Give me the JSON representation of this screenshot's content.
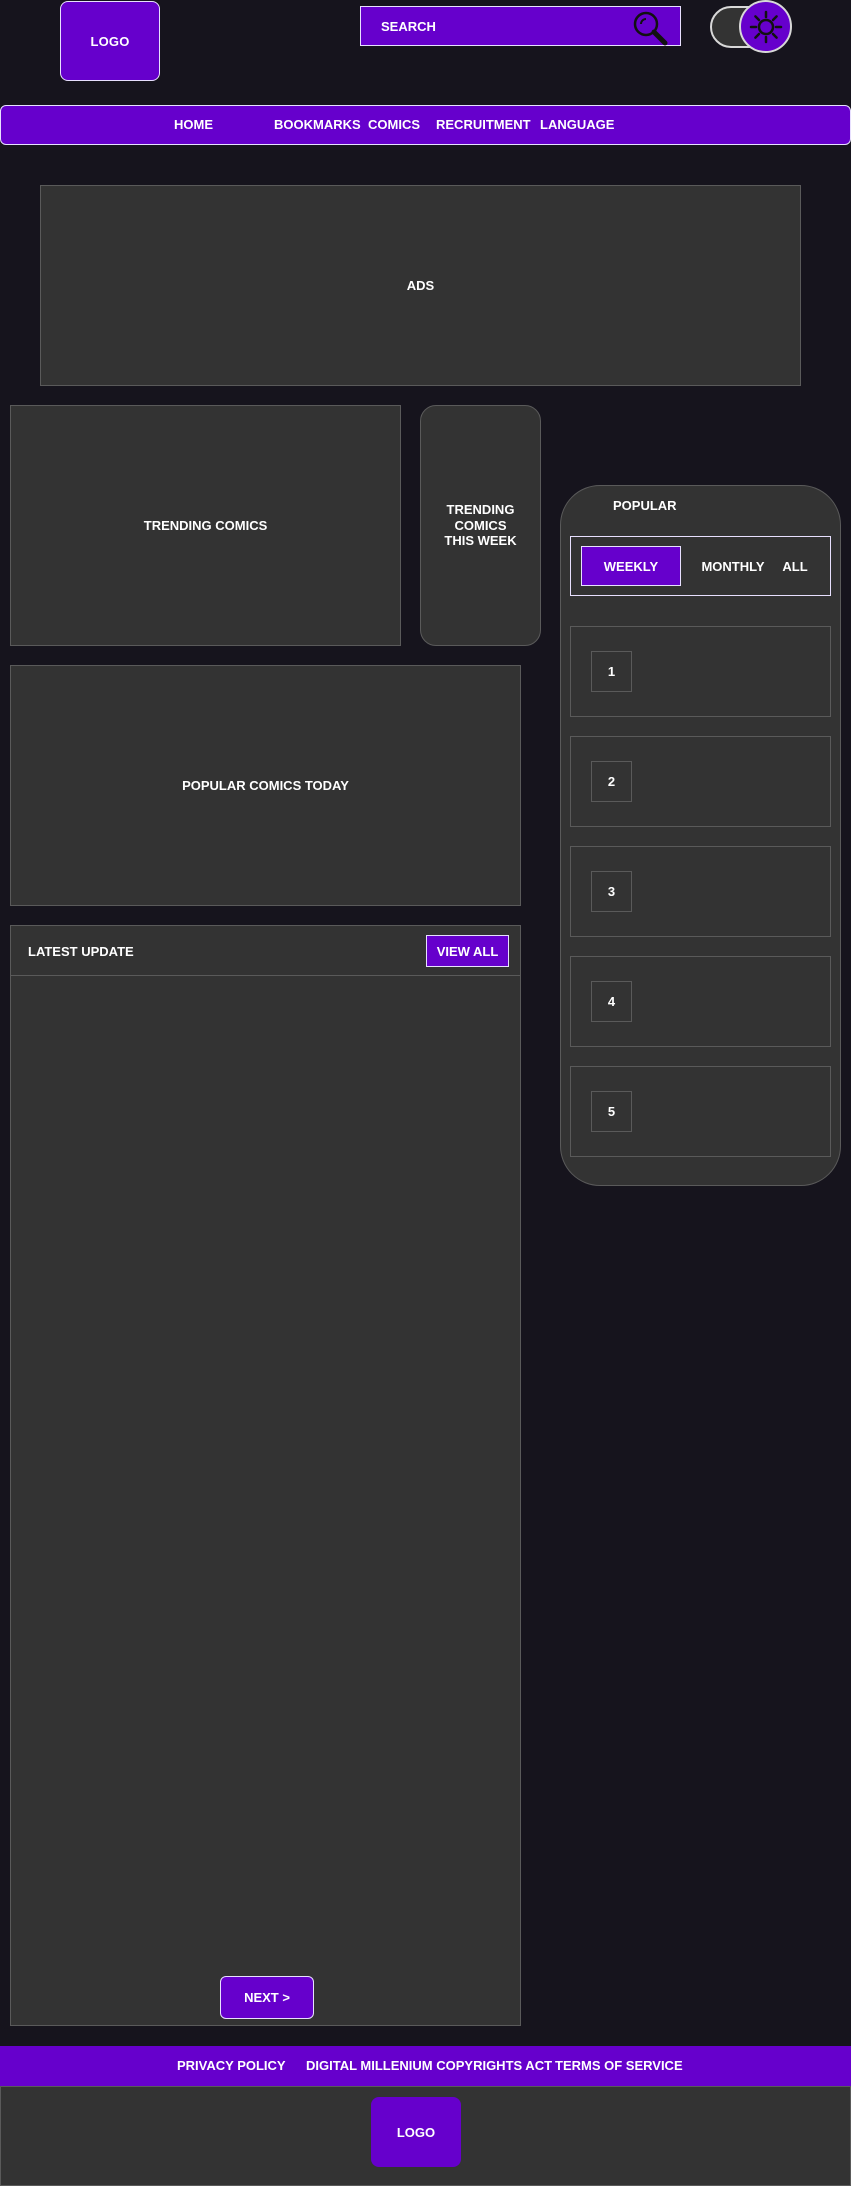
{
  "header": {
    "logo_text": "LOGO",
    "search_placeholder": "SEARCH",
    "search_icon": "magnifier-icon",
    "theme_icon": "sun-icon"
  },
  "nav": {
    "items": [
      "HOME",
      "BOOKMARKS",
      "COMICS",
      "RECRUITMENT",
      "LANGUAGE"
    ]
  },
  "ads": {
    "label": "ADS"
  },
  "trending": {
    "label": "TRENDING COMICS"
  },
  "trending_week": {
    "line1": "TRENDING",
    "line2": "COMICS",
    "line3": "THIS WEEK"
  },
  "popular_today": {
    "label": "POPULAR COMICS TODAY"
  },
  "latest": {
    "title": "LATEST UPDATE",
    "view_all": "VIEW ALL",
    "next": "NEXT >"
  },
  "popular": {
    "title": "POPULAR",
    "tabs": [
      "WEEKLY",
      "MONTHLY",
      "ALL"
    ],
    "ranks": [
      "1",
      "2",
      "3",
      "4",
      "5"
    ]
  },
  "footer": {
    "links": [
      "PRIVACY POLICY",
      "DIGITAL MILLENIUM COPYRIGHTS ACT",
      "TERMS OF SERVICE"
    ],
    "logo_text": "LOGO"
  },
  "colors": {
    "background": "#16141d",
    "accent": "#6600cc",
    "panel": "#333333"
  }
}
